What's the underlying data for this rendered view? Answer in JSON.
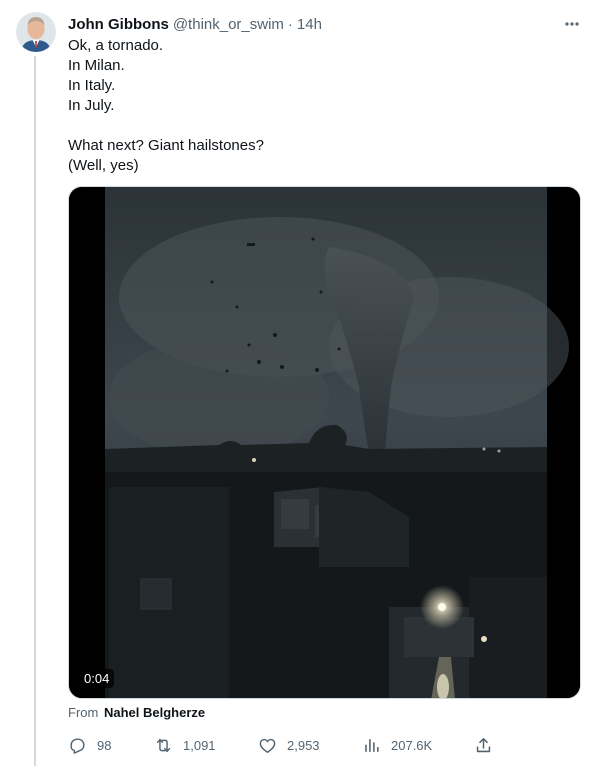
{
  "tweet": {
    "author_name": "John Gibbons",
    "author_handle": "@think_or_swim",
    "separator": "·",
    "time": "14h",
    "text_lines": [
      "Ok, a tornado.",
      "In Milan.",
      "In Italy.",
      "In July.",
      "",
      "What next? Giant hailstones?",
      "(Well, yes)"
    ],
    "media": {
      "type": "video",
      "duration": "0:04"
    },
    "attribution": {
      "prefix": "From",
      "source": "Nahel Belgherze"
    },
    "actions": {
      "replies": "98",
      "retweets": "1,091",
      "likes": "2,953",
      "views": "207.6K"
    }
  },
  "icons": {
    "more": "more-dots-icon",
    "reply": "reply-icon",
    "retweet": "retweet-icon",
    "like": "heart-icon",
    "views": "views-icon",
    "share": "share-icon"
  },
  "colors": {
    "text_primary": "#0f1419",
    "text_secondary": "#536471",
    "divider": "#cfd9de"
  }
}
